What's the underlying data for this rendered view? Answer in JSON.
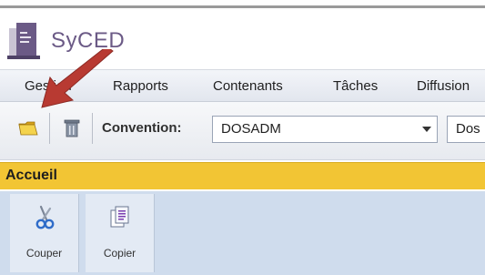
{
  "app": {
    "logo_text": "SyCED"
  },
  "menu": {
    "items": [
      {
        "label": "Gestion"
      },
      {
        "label": "Rapports"
      },
      {
        "label": "Contenants"
      },
      {
        "label": "Tâches"
      },
      {
        "label": "Diffusion"
      }
    ]
  },
  "toolbar": {
    "icons": [
      "folder-icon",
      "recycle-bin-icon"
    ],
    "convention_label": "Convention:",
    "convention_value": "DOSADM",
    "second_combo_value": "Dos"
  },
  "section": {
    "title": "Accueil"
  },
  "ribbon": {
    "buttons": [
      {
        "label": "Couper",
        "icon": "scissors-icon"
      },
      {
        "label": "Copier",
        "icon": "copy-document-icon"
      }
    ]
  },
  "colors": {
    "accent_yellow": "#f2c534",
    "annotation_arrow": "#b83a32",
    "logo_purple": "#6b5a86"
  }
}
